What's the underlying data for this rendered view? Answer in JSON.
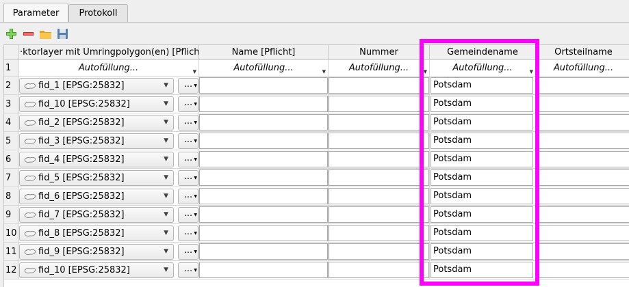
{
  "tabs": [
    {
      "label": "Parameter",
      "active": true
    },
    {
      "label": "Protokoll",
      "active": false
    }
  ],
  "toolbar": [
    {
      "icon": "plus-icon",
      "color": "#3a9d23"
    },
    {
      "icon": "minus-icon",
      "color": "#d62828"
    },
    {
      "icon": "folder-icon",
      "color": "#f2b531"
    },
    {
      "icon": "save-icon",
      "color": "#5b7fa8"
    }
  ],
  "columns": [
    "·ktorlayer mit Umringpolygon(en) [Pflicht]",
    "Name [Pflicht]",
    "Nummer",
    "Gemeindename",
    "Ortsteilname"
  ],
  "autofill_label": "Autofüllung...",
  "rows": [
    {
      "num": "2",
      "layer": "fid_1 [EPSG:25832]",
      "gemeinde": "Potsdam"
    },
    {
      "num": "3",
      "layer": "fid_10 [EPSG:25832]",
      "gemeinde": "Potsdam"
    },
    {
      "num": "4",
      "layer": "fid_2 [EPSG:25832]",
      "gemeinde": "Potsdam"
    },
    {
      "num": "5",
      "layer": "fid_3 [EPSG:25832]",
      "gemeinde": "Potsdam"
    },
    {
      "num": "6",
      "layer": "fid_4 [EPSG:25832]",
      "gemeinde": "Potsdam"
    },
    {
      "num": "7",
      "layer": "fid_5 [EPSG:25832]",
      "gemeinde": "Potsdam"
    },
    {
      "num": "8",
      "layer": "fid_6 [EPSG:25832]",
      "gemeinde": "Potsdam"
    },
    {
      "num": "9",
      "layer": "fid_7 [EPSG:25832]",
      "gemeinde": "Potsdam"
    },
    {
      "num": "10",
      "layer": "fid_8 [EPSG:25832]",
      "gemeinde": "Potsdam"
    },
    {
      "num": "11",
      "layer": "fid_9 [EPSG:25832]",
      "gemeinde": "Potsdam"
    },
    {
      "num": "12",
      "layer": "fid_10 [EPSG:25832]",
      "gemeinde": "Potsdam"
    }
  ],
  "first_row_num": "1",
  "dots_label": "...",
  "highlight_color": "#ff00ff"
}
